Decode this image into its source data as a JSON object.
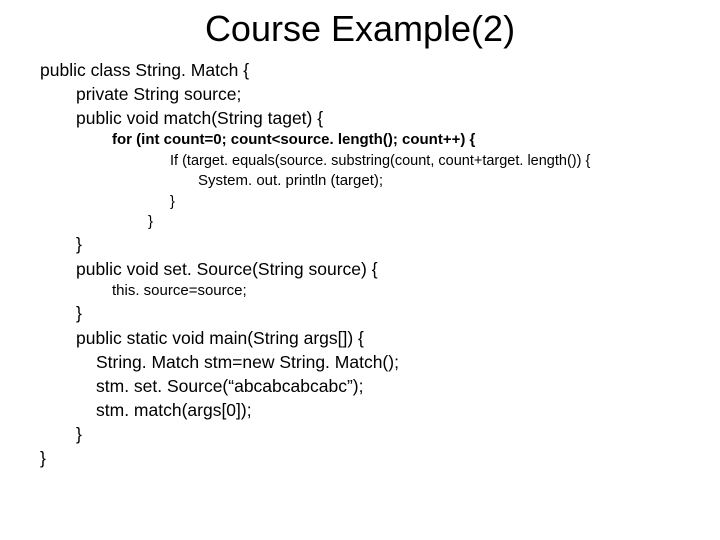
{
  "title": "Course Example(2)",
  "lines": {
    "l1": "public class String. Match {",
    "l2": "private String source;",
    "l3": "public void match(String taget) {",
    "l4": "for (int count=0; count<source. length(); count++) {",
    "l5": "If (target. equals(source. substring(count, count+target. length()) {",
    "l6": "System. out. println (target);",
    "l7": "}",
    "l8": "}",
    "l9": "}",
    "l10": "public void set. Source(String source) {",
    "l11": "this. source=source;",
    "l12": "}",
    "l13": "public static void main(String args[]) {",
    "l14": "String. Match stm=new String. Match();",
    "l15": "stm. set. Source(“abcabcabcabc”);",
    "l16": "stm. match(args[0]);",
    "l17": "}",
    "l18": "}"
  }
}
